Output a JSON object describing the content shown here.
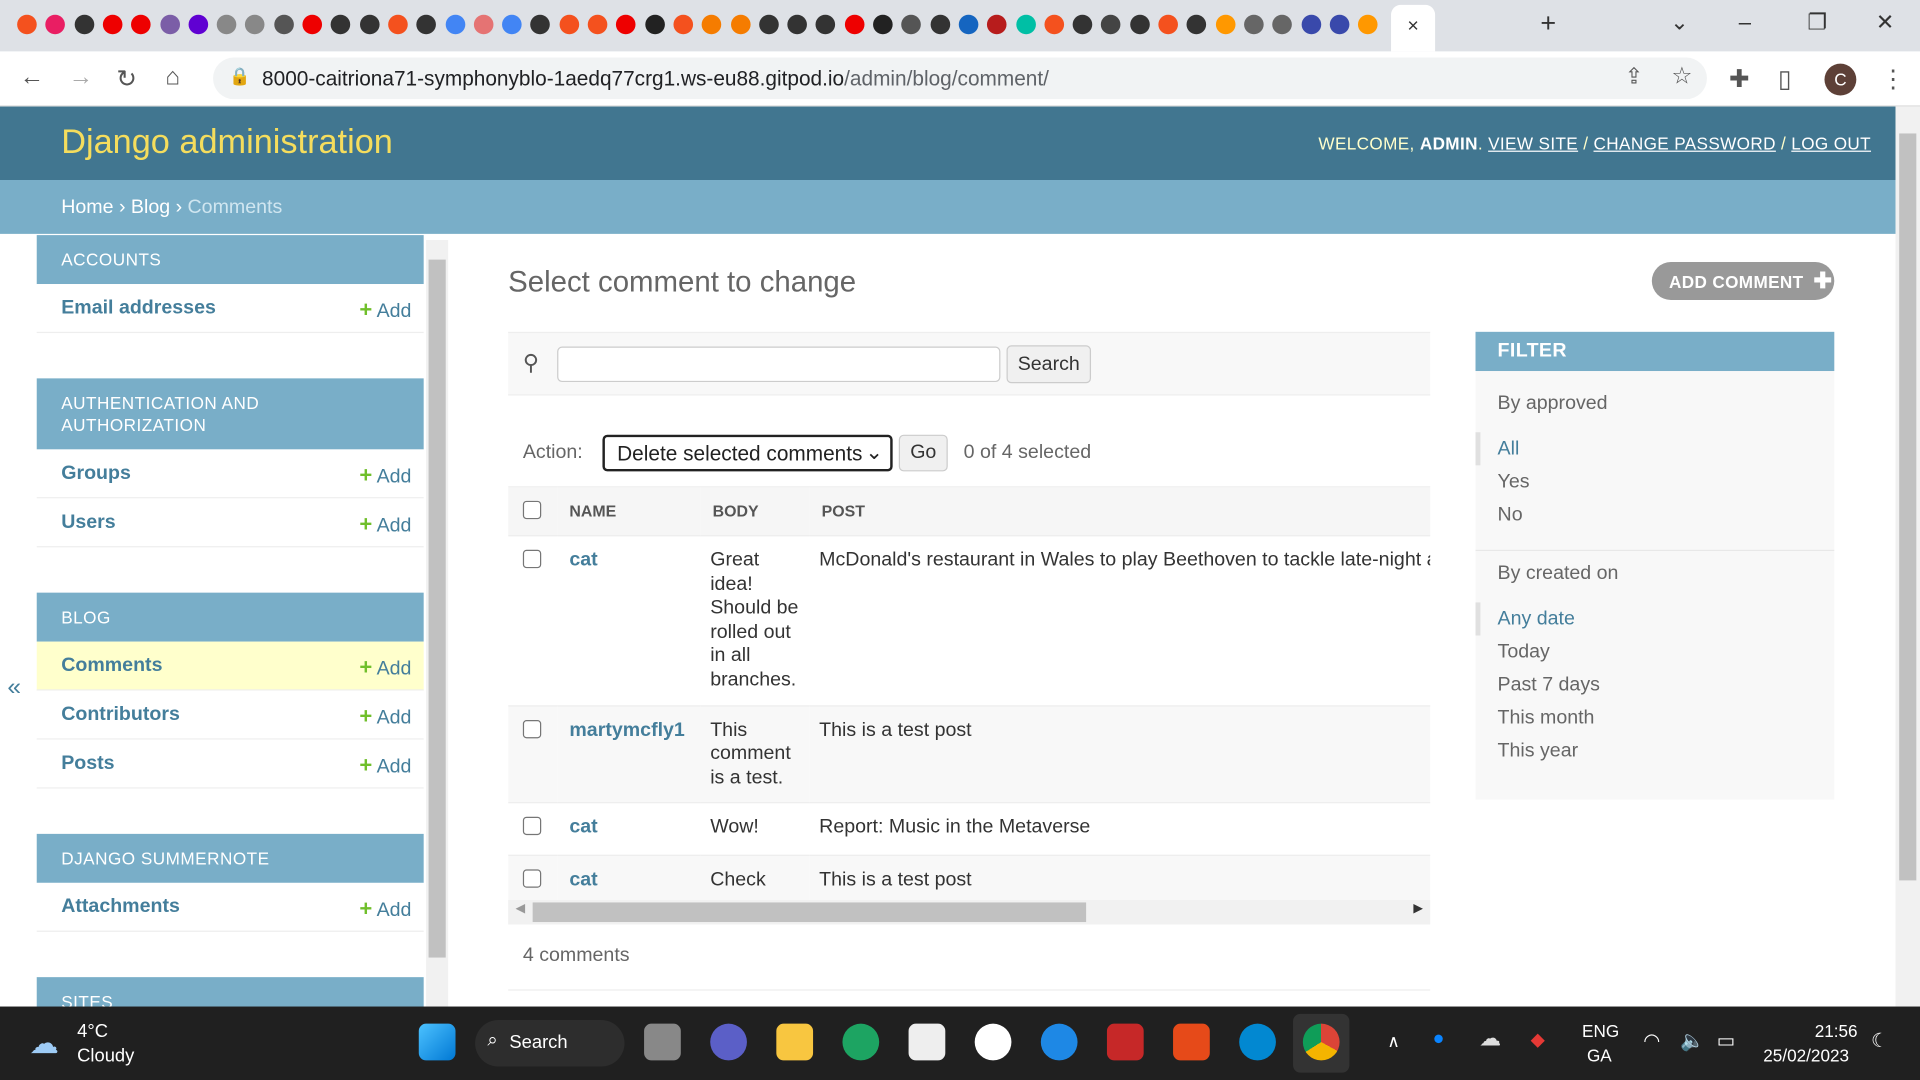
{
  "browser": {
    "tab_close": "×",
    "new_tab": "+",
    "url_host": "8000-caitriona71-symphonyblo-1aedq77crg1.ws-eu88.gitpod.io",
    "url_path": "/admin/blog/comment/",
    "profile_initial": "C",
    "tab_favicon_colors": [
      "#f4511e",
      "#e91e63",
      "#333",
      "#e00",
      "#e00",
      "#7b5ea7",
      "#6001d2",
      "#888",
      "#888",
      "#555",
      "#e00",
      "#333",
      "#333",
      "#f4511e",
      "#333",
      "#4285f4",
      "#e57373",
      "#4285f4",
      "#333",
      "#f4511e",
      "#f4511e",
      "#e00",
      "#222",
      "#f4511e",
      "#f57c00",
      "#f57c00",
      "#333",
      "#333",
      "#333",
      "#e00",
      "#222",
      "#555",
      "#333",
      "#1565c0",
      "#b71c1c",
      "#00bfa5",
      "#f4511e",
      "#333",
      "#444",
      "#333",
      "#f4511e",
      "#333",
      "#ff9800",
      "#666",
      "#666",
      "#3949ab",
      "#3949ab",
      "#ff9800"
    ]
  },
  "header": {
    "title": "Django administration",
    "welcome": "WELCOME, ",
    "user": "ADMIN",
    "view_site": "VIEW SITE",
    "change_password": "CHANGE PASSWORD",
    "log_out": "LOG OUT"
  },
  "breadcrumbs": {
    "home": "Home",
    "app": "Blog",
    "current": "Comments"
  },
  "sidebar": {
    "collapse": "«",
    "add_label": "Add",
    "sections": [
      {
        "caption": "ACCOUNTS",
        "items": [
          "Email addresses"
        ]
      },
      {
        "caption": "AUTHENTICATION AND AUTHORIZATION",
        "items": [
          "Groups",
          "Users"
        ]
      },
      {
        "caption": "BLOG",
        "items": [
          "Comments",
          "Contributors",
          "Posts"
        ]
      },
      {
        "caption": "DJANGO SUMMERNOTE",
        "items": [
          "Attachments"
        ]
      },
      {
        "caption": "SITES",
        "items": []
      }
    ]
  },
  "main": {
    "title": "Select comment to change",
    "add_button": "ADD COMMENT",
    "search_value": "",
    "search_button": "Search",
    "action_label": "Action:",
    "action_selected": "Delete selected comments",
    "go": "Go",
    "selection_count": "0 of 4 selected",
    "columns": [
      "NAME",
      "BODY",
      "POST"
    ],
    "rows": [
      {
        "name": "cat",
        "body": "Great idea! Should be rolled out in all branches.",
        "post": "McDonald's restaurant in Wales to play Beethoven to tackle late-night a"
      },
      {
        "name": "martymcfly1",
        "body": "This comment is a test.",
        "post": "This is a test post"
      },
      {
        "name": "cat",
        "body": "Wow!",
        "post": "Report: Music in the Metaverse"
      },
      {
        "name": "cat",
        "body": "Check",
        "post": "This is a test post"
      }
    ],
    "total": "4 comments"
  },
  "filter": {
    "title": "FILTER",
    "groups": [
      {
        "label": "By approved",
        "options": [
          "All",
          "Yes",
          "No"
        ],
        "selected": "All"
      },
      {
        "label": "By created on",
        "options": [
          "Any date",
          "Today",
          "Past 7 days",
          "This month",
          "This year"
        ],
        "selected": "Any date"
      }
    ]
  },
  "taskbar": {
    "temp": "4°C",
    "weather": "Cloudy",
    "search": "Search",
    "lang1": "ENG",
    "lang2": "GA",
    "time": "21:56",
    "date": "25/02/2023"
  }
}
